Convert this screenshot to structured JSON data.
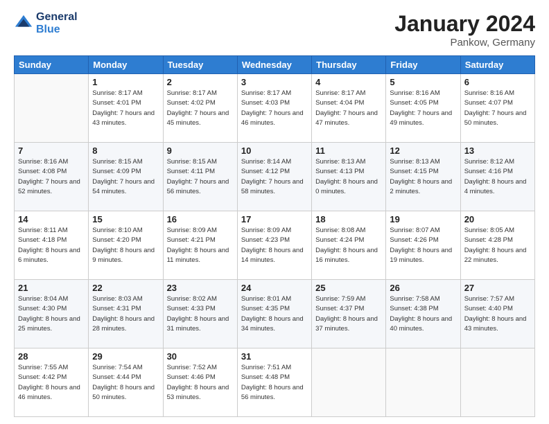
{
  "header": {
    "logo_line1": "General",
    "logo_line2": "Blue",
    "title": "January 2024",
    "subtitle": "Pankow, Germany"
  },
  "weekdays": [
    "Sunday",
    "Monday",
    "Tuesday",
    "Wednesday",
    "Thursday",
    "Friday",
    "Saturday"
  ],
  "weeks": [
    [
      {
        "day": "",
        "sunrise": "",
        "sunset": "",
        "daylight": ""
      },
      {
        "day": "1",
        "sunrise": "Sunrise: 8:17 AM",
        "sunset": "Sunset: 4:01 PM",
        "daylight": "Daylight: 7 hours and 43 minutes."
      },
      {
        "day": "2",
        "sunrise": "Sunrise: 8:17 AM",
        "sunset": "Sunset: 4:02 PM",
        "daylight": "Daylight: 7 hours and 45 minutes."
      },
      {
        "day": "3",
        "sunrise": "Sunrise: 8:17 AM",
        "sunset": "Sunset: 4:03 PM",
        "daylight": "Daylight: 7 hours and 46 minutes."
      },
      {
        "day": "4",
        "sunrise": "Sunrise: 8:17 AM",
        "sunset": "Sunset: 4:04 PM",
        "daylight": "Daylight: 7 hours and 47 minutes."
      },
      {
        "day": "5",
        "sunrise": "Sunrise: 8:16 AM",
        "sunset": "Sunset: 4:05 PM",
        "daylight": "Daylight: 7 hours and 49 minutes."
      },
      {
        "day": "6",
        "sunrise": "Sunrise: 8:16 AM",
        "sunset": "Sunset: 4:07 PM",
        "daylight": "Daylight: 7 hours and 50 minutes."
      }
    ],
    [
      {
        "day": "7",
        "sunrise": "Sunrise: 8:16 AM",
        "sunset": "Sunset: 4:08 PM",
        "daylight": "Daylight: 7 hours and 52 minutes."
      },
      {
        "day": "8",
        "sunrise": "Sunrise: 8:15 AM",
        "sunset": "Sunset: 4:09 PM",
        "daylight": "Daylight: 7 hours and 54 minutes."
      },
      {
        "day": "9",
        "sunrise": "Sunrise: 8:15 AM",
        "sunset": "Sunset: 4:11 PM",
        "daylight": "Daylight: 7 hours and 56 minutes."
      },
      {
        "day": "10",
        "sunrise": "Sunrise: 8:14 AM",
        "sunset": "Sunset: 4:12 PM",
        "daylight": "Daylight: 7 hours and 58 minutes."
      },
      {
        "day": "11",
        "sunrise": "Sunrise: 8:13 AM",
        "sunset": "Sunset: 4:13 PM",
        "daylight": "Daylight: 8 hours and 0 minutes."
      },
      {
        "day": "12",
        "sunrise": "Sunrise: 8:13 AM",
        "sunset": "Sunset: 4:15 PM",
        "daylight": "Daylight: 8 hours and 2 minutes."
      },
      {
        "day": "13",
        "sunrise": "Sunrise: 8:12 AM",
        "sunset": "Sunset: 4:16 PM",
        "daylight": "Daylight: 8 hours and 4 minutes."
      }
    ],
    [
      {
        "day": "14",
        "sunrise": "Sunrise: 8:11 AM",
        "sunset": "Sunset: 4:18 PM",
        "daylight": "Daylight: 8 hours and 6 minutes."
      },
      {
        "day": "15",
        "sunrise": "Sunrise: 8:10 AM",
        "sunset": "Sunset: 4:20 PM",
        "daylight": "Daylight: 8 hours and 9 minutes."
      },
      {
        "day": "16",
        "sunrise": "Sunrise: 8:09 AM",
        "sunset": "Sunset: 4:21 PM",
        "daylight": "Daylight: 8 hours and 11 minutes."
      },
      {
        "day": "17",
        "sunrise": "Sunrise: 8:09 AM",
        "sunset": "Sunset: 4:23 PM",
        "daylight": "Daylight: 8 hours and 14 minutes."
      },
      {
        "day": "18",
        "sunrise": "Sunrise: 8:08 AM",
        "sunset": "Sunset: 4:24 PM",
        "daylight": "Daylight: 8 hours and 16 minutes."
      },
      {
        "day": "19",
        "sunrise": "Sunrise: 8:07 AM",
        "sunset": "Sunset: 4:26 PM",
        "daylight": "Daylight: 8 hours and 19 minutes."
      },
      {
        "day": "20",
        "sunrise": "Sunrise: 8:05 AM",
        "sunset": "Sunset: 4:28 PM",
        "daylight": "Daylight: 8 hours and 22 minutes."
      }
    ],
    [
      {
        "day": "21",
        "sunrise": "Sunrise: 8:04 AM",
        "sunset": "Sunset: 4:30 PM",
        "daylight": "Daylight: 8 hours and 25 minutes."
      },
      {
        "day": "22",
        "sunrise": "Sunrise: 8:03 AM",
        "sunset": "Sunset: 4:31 PM",
        "daylight": "Daylight: 8 hours and 28 minutes."
      },
      {
        "day": "23",
        "sunrise": "Sunrise: 8:02 AM",
        "sunset": "Sunset: 4:33 PM",
        "daylight": "Daylight: 8 hours and 31 minutes."
      },
      {
        "day": "24",
        "sunrise": "Sunrise: 8:01 AM",
        "sunset": "Sunset: 4:35 PM",
        "daylight": "Daylight: 8 hours and 34 minutes."
      },
      {
        "day": "25",
        "sunrise": "Sunrise: 7:59 AM",
        "sunset": "Sunset: 4:37 PM",
        "daylight": "Daylight: 8 hours and 37 minutes."
      },
      {
        "day": "26",
        "sunrise": "Sunrise: 7:58 AM",
        "sunset": "Sunset: 4:38 PM",
        "daylight": "Daylight: 8 hours and 40 minutes."
      },
      {
        "day": "27",
        "sunrise": "Sunrise: 7:57 AM",
        "sunset": "Sunset: 4:40 PM",
        "daylight": "Daylight: 8 hours and 43 minutes."
      }
    ],
    [
      {
        "day": "28",
        "sunrise": "Sunrise: 7:55 AM",
        "sunset": "Sunset: 4:42 PM",
        "daylight": "Daylight: 8 hours and 46 minutes."
      },
      {
        "day": "29",
        "sunrise": "Sunrise: 7:54 AM",
        "sunset": "Sunset: 4:44 PM",
        "daylight": "Daylight: 8 hours and 50 minutes."
      },
      {
        "day": "30",
        "sunrise": "Sunrise: 7:52 AM",
        "sunset": "Sunset: 4:46 PM",
        "daylight": "Daylight: 8 hours and 53 minutes."
      },
      {
        "day": "31",
        "sunrise": "Sunrise: 7:51 AM",
        "sunset": "Sunset: 4:48 PM",
        "daylight": "Daylight: 8 hours and 56 minutes."
      },
      {
        "day": "",
        "sunrise": "",
        "sunset": "",
        "daylight": ""
      },
      {
        "day": "",
        "sunrise": "",
        "sunset": "",
        "daylight": ""
      },
      {
        "day": "",
        "sunrise": "",
        "sunset": "",
        "daylight": ""
      }
    ]
  ]
}
